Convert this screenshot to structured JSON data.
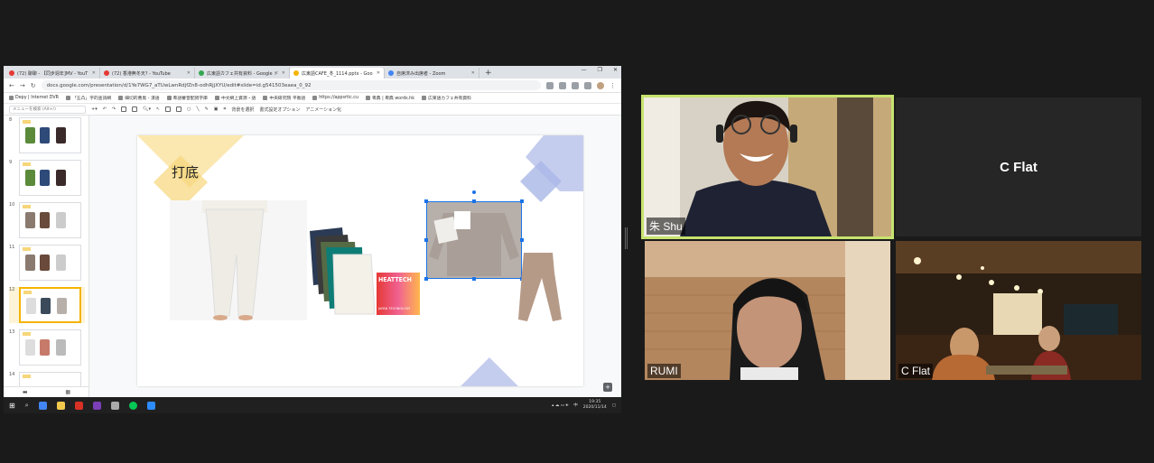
{
  "browser": {
    "tabs": [
      {
        "label": "(72) 聊聊 - 【同步週年]MV - YouT",
        "color": "#e53935"
      },
      {
        "label": "(72) 香港無冬天? - YouTube",
        "color": "#e53935"
      },
      {
        "label": "広東語カフェ共有資料 - Google ド",
        "color": "#34a853"
      },
      {
        "label": "広東語CAFE_冬_1114.pptx - Goo",
        "color": "#f4b400"
      },
      {
        "label": "自席済み出席者 - Zoom",
        "color": "#4285f4"
      }
    ],
    "new_tab": "+",
    "window_controls": [
      "—",
      "❐",
      "✕"
    ],
    "url": "docs.google.com/presentation/d/1Ye7WG7_aTUwLwnRdjfZn8-odhRjjXYU/edit#slide=id.g541503eaea_0_92",
    "bookmarks": [
      "Depy | Internet DVR",
      "「五凸」字的查詢網",
      "細切的曹黒 - 漢語",
      "粵語審音配詞字庫",
      "中文網上資源・語",
      "中央研究院 平衡語",
      "https://appsrtic.cu",
      "粵典 | 粵典 words.hk",
      "広東語カフェ共有資料"
    ],
    "menu_search_placeholder": "メニューを検索 (Alt+/)",
    "toolbar_labels": [
      "背景を選択",
      "書式設定オプション",
      "アニメーション化"
    ]
  },
  "slides_panel": {
    "thumbs": [
      "8",
      "9",
      "10",
      "11",
      "12",
      "13",
      "14"
    ],
    "selected": "12"
  },
  "slide": {
    "title": "打底",
    "logo_text": "HEATTECH",
    "logo_sub": "JAPAN TECHNOLOGY"
  },
  "taskbar": {
    "time": "19:35",
    "date": "2020/11/14",
    "ime": "中"
  },
  "zoom": {
    "participants": [
      {
        "name": "朱 Shu",
        "speaking": true
      },
      {
        "name": "C Flat",
        "video": false
      },
      {
        "name": "RUMI"
      },
      {
        "name": "C Flat"
      }
    ]
  }
}
